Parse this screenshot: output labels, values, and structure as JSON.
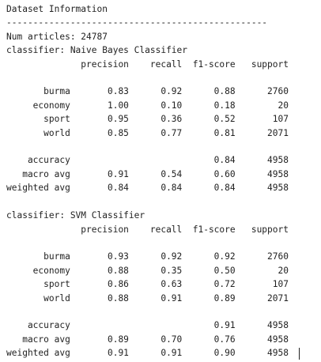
{
  "output": {
    "lines": [
      "Dataset Information",
      "-------------------------------------------------",
      "Num articles: 24787",
      "classifier: Naive Bayes Classifier",
      "              precision    recall  f1-score   support",
      "",
      "       burma       0.83      0.92      0.88      2760",
      "     economy       1.00      0.10      0.18        20",
      "       sport       0.95      0.36      0.52       107",
      "       world       0.85      0.77      0.81      2071",
      "",
      "    accuracy                           0.84      4958",
      "   macro avg       0.91      0.54      0.60      4958",
      "weighted avg       0.84      0.84      0.84      4958",
      "",
      "classifier: SVM Classifier",
      "              precision    recall  f1-score   support",
      "",
      "       burma       0.93      0.92      0.92      2760",
      "     economy       0.88      0.35      0.50        20",
      "       sport       0.86      0.63      0.72       107",
      "       world       0.88      0.91      0.89      2071",
      "",
      "    accuracy                           0.91      4958",
      "   macro avg       0.89      0.70      0.76      4958",
      "weighted avg       0.91      0.91      0.90      4958"
    ]
  }
}
